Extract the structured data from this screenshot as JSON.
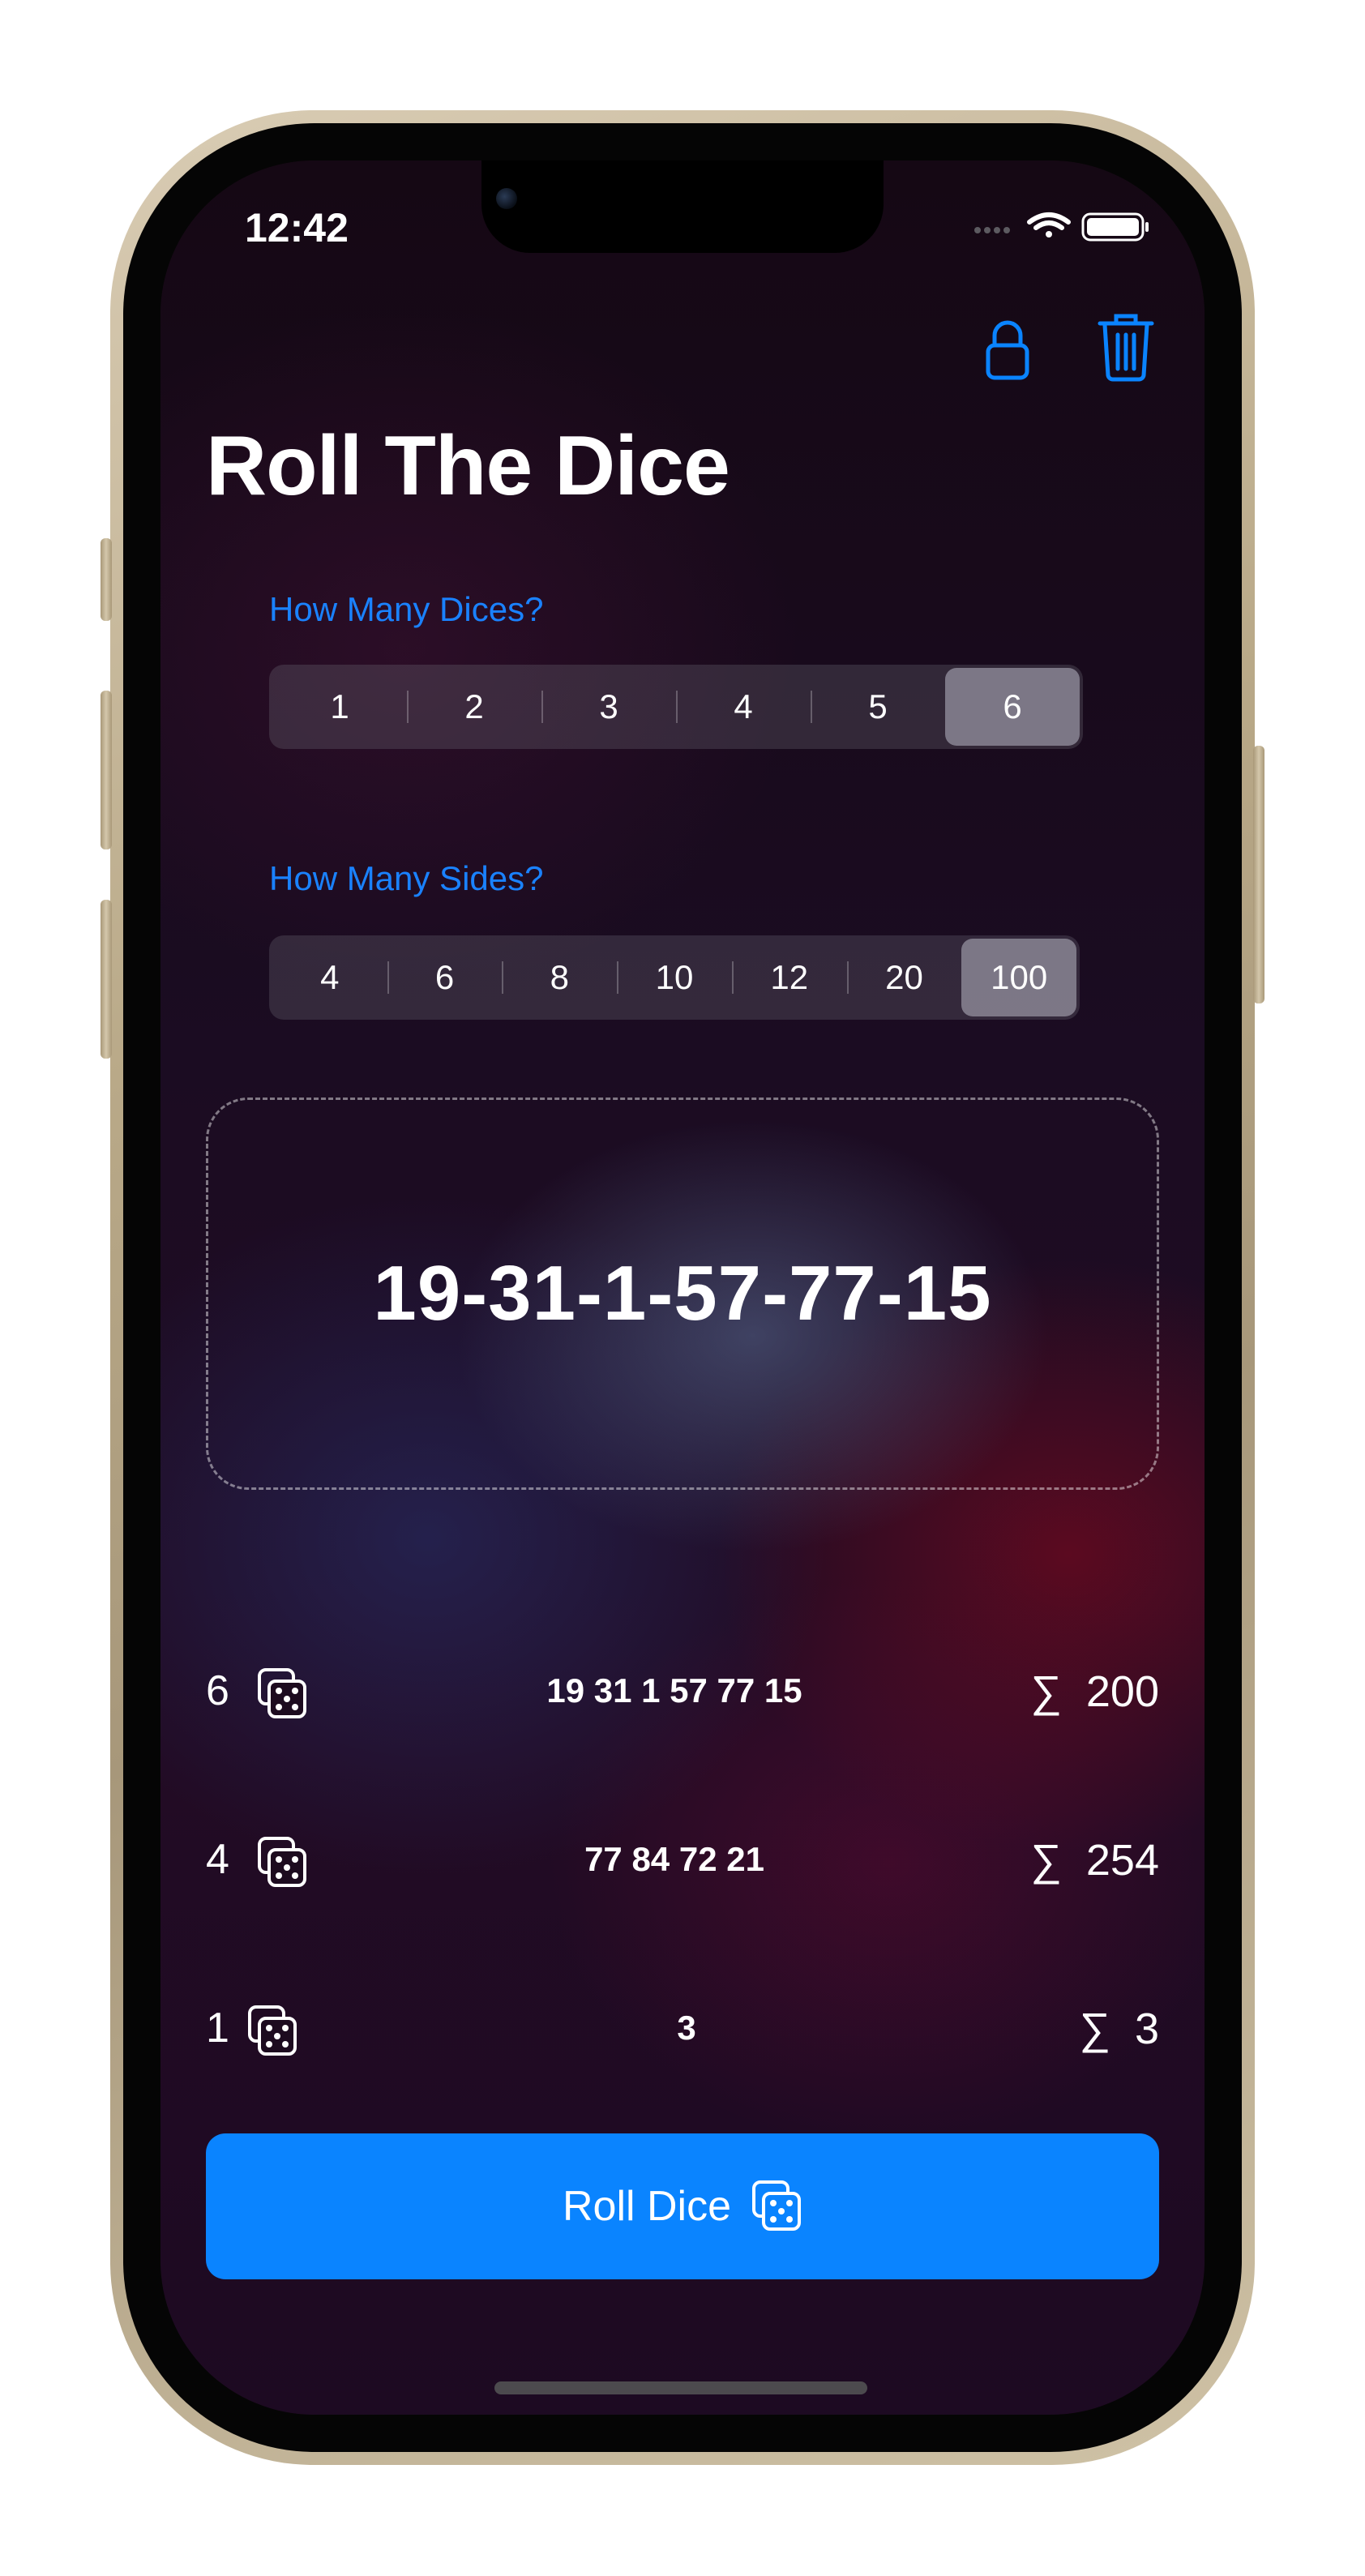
{
  "status_bar": {
    "time": "12:42"
  },
  "toolbar": {
    "lock_icon": "lock-icon",
    "trash_icon": "trash-icon"
  },
  "page": {
    "title": "Roll The Dice"
  },
  "dice_count": {
    "label": "How Many Dices?",
    "options": [
      "1",
      "2",
      "3",
      "4",
      "5",
      "6"
    ],
    "selected": "6"
  },
  "sides_count": {
    "label": "How Many Sides?",
    "options": [
      "4",
      "6",
      "8",
      "10",
      "12",
      "20",
      "100"
    ],
    "selected": "100"
  },
  "result": {
    "text": "19-31-1-57-77-15"
  },
  "history": [
    {
      "count": "6",
      "rolls": "19 31 1 57 77 15",
      "sum_symbol": "∑",
      "sum": "200"
    },
    {
      "count": "4",
      "rolls": "77 84 72 21",
      "sum_symbol": "∑",
      "sum": "254"
    },
    {
      "count": "1",
      "rolls": "3",
      "sum_symbol": "∑",
      "sum": "3"
    }
  ],
  "roll_button": {
    "label": "Roll Dice",
    "icon": "dice-icon"
  },
  "colors": {
    "accent": "#0a84ff",
    "label_blue": "#1a82ff",
    "background": "#1a0a1c"
  }
}
